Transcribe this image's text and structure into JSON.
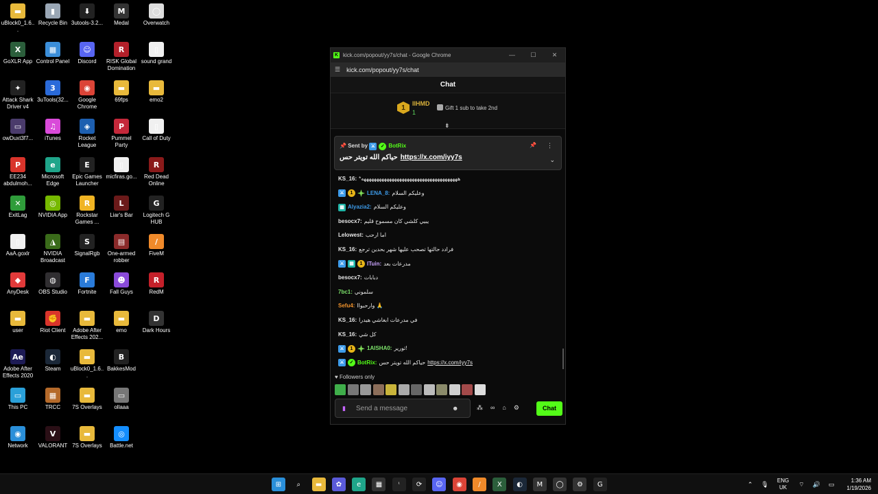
{
  "desktop": {
    "icons": [
      {
        "label": "uBlock0_1.6...",
        "color": "#e8b93b",
        "glyph": "▬"
      },
      {
        "label": "GoXLR App",
        "color": "#2b5e3b",
        "glyph": "X"
      },
      {
        "label": "Attack Shark Driver v4",
        "color": "#222",
        "glyph": "✦"
      },
      {
        "label": "owDuxt3f7...",
        "color": "#4a3b6b",
        "glyph": "▭"
      },
      {
        "label": "EE234 abdulmoh...",
        "color": "#d9342b",
        "glyph": "P"
      },
      {
        "label": "ExitLag",
        "color": "#2f9c3a",
        "glyph": "✕"
      },
      {
        "label": "AaA.goxlr",
        "color": "#f0f0f0",
        "glyph": "▯"
      },
      {
        "label": "AnyDesk",
        "color": "#e23a3a",
        "glyph": "◆"
      },
      {
        "label": "user",
        "color": "#e8b93b",
        "glyph": "▬"
      },
      {
        "label": "Adobe After Effects 2020",
        "color": "#1d1b55",
        "glyph": "Ae"
      },
      {
        "label": "This PC",
        "color": "#2aa0d9",
        "glyph": "▭"
      },
      {
        "label": "Network",
        "color": "#2a8fd9",
        "glyph": "◉"
      },
      {
        "label": "Recycle Bin",
        "color": "#9aa7b5",
        "glyph": "▮"
      },
      {
        "label": "Control Panel",
        "color": "#3b8ed9",
        "glyph": "▦"
      },
      {
        "label": "3uTools(32...",
        "color": "#2a6ad9",
        "glyph": "3"
      },
      {
        "label": "iTunes",
        "color": "#d94ad9",
        "glyph": "♫"
      },
      {
        "label": "Microsoft Edge",
        "color": "#1fa58a",
        "glyph": "e"
      },
      {
        "label": "NVIDIA App",
        "color": "#76b900",
        "glyph": "◎"
      },
      {
        "label": "NVIDIA Broadcast",
        "color": "#3a6b1a",
        "glyph": "◮"
      },
      {
        "label": "OBS Studio",
        "color": "#302e31",
        "glyph": "◍"
      },
      {
        "label": "Riot Client",
        "color": "#d9342b",
        "glyph": "✊"
      },
      {
        "label": "Steam",
        "color": "#1b2838",
        "glyph": "◐"
      },
      {
        "label": "TRCC",
        "color": "#b56a2a",
        "glyph": "▦"
      },
      {
        "label": "VALORANT",
        "color": "#2a0f16",
        "glyph": "V"
      },
      {
        "label": "3utools-3.2...",
        "color": "#222",
        "glyph": "⬇"
      },
      {
        "label": "Discord",
        "color": "#5865f2",
        "glyph": "☺"
      },
      {
        "label": "Google Chrome",
        "color": "#db4437",
        "glyph": "◉"
      },
      {
        "label": "Rocket League",
        "color": "#1d5fb0",
        "glyph": "◈"
      },
      {
        "label": "Epic Games Launcher",
        "color": "#222",
        "glyph": "E"
      },
      {
        "label": "Rockstar Games ...",
        "color": "#f0b423",
        "glyph": "R"
      },
      {
        "label": "SignalRgb",
        "color": "#222",
        "glyph": "S"
      },
      {
        "label": "Fortnite",
        "color": "#2a7bd9",
        "glyph": "F"
      },
      {
        "label": "Adobe After Effects 202...",
        "color": "#e8b93b",
        "glyph": "▬"
      },
      {
        "label": "uBlock0_1.6...",
        "color": "#e8b93b",
        "glyph": "▬"
      },
      {
        "label": "7S Overlays",
        "color": "#e8b93b",
        "glyph": "▬"
      },
      {
        "label": "7S Overlays",
        "color": "#e8b93b",
        "glyph": "▬"
      },
      {
        "label": "Medal",
        "color": "#333",
        "glyph": "M"
      },
      {
        "label": "RISK Global Domination",
        "color": "#b3202a",
        "glyph": "R"
      },
      {
        "label": "69fps",
        "color": "#e8b93b",
        "glyph": "▬"
      },
      {
        "label": "Pummel Party",
        "color": "#c4283a",
        "glyph": "P"
      },
      {
        "label": "micfiras.go...",
        "color": "#f0f0f0",
        "glyph": "▯"
      },
      {
        "label": "Liar's Bar",
        "color": "#6b1a1a",
        "glyph": "L"
      },
      {
        "label": "One-armed robber",
        "color": "#8a2a2a",
        "glyph": "▤"
      },
      {
        "label": "Fall Guys",
        "color": "#8a4ad9",
        "glyph": "☻"
      },
      {
        "label": "emo",
        "color": "#e8b93b",
        "glyph": "▬"
      },
      {
        "label": "BakkesMod",
        "color": "#222",
        "glyph": "B"
      },
      {
        "label": "ollaaa",
        "color": "#777",
        "glyph": "▭"
      },
      {
        "label": "Battle.net",
        "color": "#148eff",
        "glyph": "◎"
      },
      {
        "label": "Overwatch",
        "color": "#ddd",
        "glyph": "◯"
      },
      {
        "label": "sound grand",
        "color": "#f0f0f0",
        "glyph": "▯"
      },
      {
        "label": "emo2",
        "color": "#e8b93b",
        "glyph": "▬"
      },
      {
        "label": "Call of Duty",
        "color": "#f0f0f0",
        "glyph": "▯"
      },
      {
        "label": "Red Dead Online",
        "color": "#8a1a1a",
        "glyph": "R"
      },
      {
        "label": "Logitech G HUB",
        "color": "#222",
        "glyph": "G"
      },
      {
        "label": "FiveM",
        "color": "#f08a2a",
        "glyph": "/"
      },
      {
        "label": "RedM",
        "color": "#c4202a",
        "glyph": "R"
      },
      {
        "label": "Dark Hours",
        "color": "#333",
        "glyph": "D"
      }
    ]
  },
  "window": {
    "title": "kick.com/popout/yy7s/chat - Google Chrome",
    "url": "kick.com/popout/yy7s/chat",
    "minimize": "—",
    "maximize": "☐",
    "close": "✕"
  },
  "chat": {
    "header": "Chat",
    "leader": {
      "rank": "1",
      "name": "IIHMD",
      "count": "1",
      "gift_text": "Gift 1 sub to take 2nd",
      "arrow": "⇟"
    },
    "pinned": {
      "sent_by": "Sent by",
      "bot_name": "BotRix",
      "text": "حياكم الله تويتر حس",
      "link": "https://x.com/iyy7s"
    },
    "messages": [
      {
        "name": "KS_16:",
        "color": "#e8e8e8",
        "badges": [],
        "text": "*ههههههههههههههههههههههههههههههههههههههه"
      },
      {
        "name": "LENA_8:",
        "color": "#3d9be9",
        "badges": [
          "mod",
          "vip",
          "og"
        ],
        "text": "وعليكم السلام"
      },
      {
        "name": "Alyazia2:",
        "color": "#3d9be9",
        "badges": [
          "sub"
        ],
        "text": "وعليكم السلام"
      },
      {
        "name": "besocx7:",
        "color": "#e8e8e8",
        "badges": [],
        "text": "يبيي كلشي كان مسموح قليم"
      },
      {
        "name": "Lelowest:",
        "color": "#e8e8e8",
        "badges": [],
        "text": "اما ارحب"
      },
      {
        "name": "KS_16:",
        "color": "#e8e8e8",
        "badges": [],
        "text": "فرادد حالتها تصحب عليها شهر بحدين ترجع"
      },
      {
        "name": "ITuin:",
        "color": "#c9a3ff",
        "badges": [
          "mod",
          "sub",
          "vip"
        ],
        "text": "مدرعات بعد"
      },
      {
        "name": "besocx7:",
        "color": "#e8e8e8",
        "badges": [],
        "text": "دبابات"
      },
      {
        "name": "7bc1:",
        "color": "#7de36b",
        "badges": [],
        "text": "سلموني"
      },
      {
        "name": "Sefu4:",
        "color": "#f0922b",
        "badges": [],
        "text": "وارحبواا 🙏"
      },
      {
        "name": "KS_16:",
        "color": "#e8e8e8",
        "badges": [],
        "text": "في مدرعات ابغاشي هيدرا"
      },
      {
        "name": "KS_16:",
        "color": "#e8e8e8",
        "badges": [],
        "text": "كل شي"
      },
      {
        "name": "1AISHA0:",
        "color": "#7de36b",
        "badges": [
          "mod",
          "vip",
          "og"
        ],
        "text": "ثورير!"
      },
      {
        "name": "BotRix:",
        "color": "#53fc18",
        "badges": [
          "mod",
          "ver"
        ],
        "text": "حياكم الله تويتر حس",
        "link": "https://x.com/iyy7s"
      }
    ],
    "followers_only": "Followers only",
    "input_placeholder": "Send a message",
    "send_label": "Chat"
  },
  "taskbar": {
    "lang_line1": "ENG",
    "lang_line2": "UK",
    "time": "1:36 AM",
    "date": "1/19/2026",
    "apps": [
      {
        "name": "start-icon",
        "glyph": "⊞",
        "color": "#2a8fd9"
      },
      {
        "name": "search-icon",
        "glyph": "⌕",
        "color": "transparent"
      },
      {
        "name": "file-explorer-icon",
        "glyph": "▬",
        "color": "#e8b93b"
      },
      {
        "name": "copilot-icon",
        "glyph": "✿",
        "color": "#5a5ad9"
      },
      {
        "name": "edge-icon",
        "glyph": "e",
        "color": "#1fa58a"
      },
      {
        "name": "store-icon",
        "glyph": "▦",
        "color": "#333"
      },
      {
        "name": "3utools-icon",
        "glyph": "ᶥ",
        "color": "#222"
      },
      {
        "name": "settings-sync-icon",
        "glyph": "⟳",
        "color": "#222"
      },
      {
        "name": "discord-icon",
        "glyph": "☺",
        "color": "#5865f2"
      },
      {
        "name": "chrome-icon",
        "glyph": "◉",
        "color": "#db4437"
      },
      {
        "name": "fivem-icon",
        "glyph": "/",
        "color": "#f08a2a"
      },
      {
        "name": "goxlr-icon",
        "glyph": "X",
        "color": "#2b5e3b"
      },
      {
        "name": "steam-icon",
        "glyph": "◐",
        "color": "#1b2838"
      },
      {
        "name": "medal-icon",
        "glyph": "M",
        "color": "#333"
      },
      {
        "name": "overwatch-icon",
        "glyph": "◯",
        "color": "#333"
      },
      {
        "name": "settings-icon",
        "glyph": "⚙",
        "color": "#333"
      },
      {
        "name": "logitech-icon",
        "glyph": "G",
        "color": "#222"
      }
    ]
  }
}
